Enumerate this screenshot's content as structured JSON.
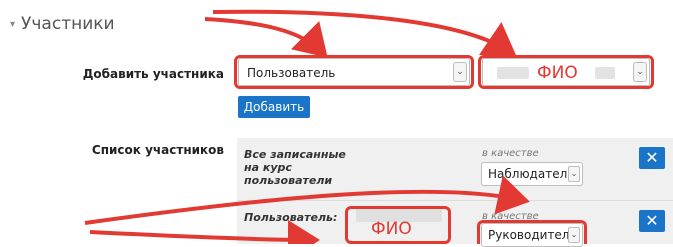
{
  "section": {
    "title": "Участники",
    "caret": "▾"
  },
  "add_participant": {
    "label": "Добавить участника",
    "select_value": "Пользователь",
    "fio_select_value": "ФИО",
    "add_button": "Добавить"
  },
  "participants_list": {
    "label": "Список участников",
    "rows": [
      {
        "who": "Все записанные на курс пользователи",
        "as_label": "в качестве",
        "role": "Наблюдатель",
        "remove": "✕"
      },
      {
        "who": "Пользователь:",
        "fio": "ФИО",
        "as_label": "в качестве",
        "role": "Руководитель",
        "remove": "✕"
      }
    ]
  },
  "annotations": {
    "color": "#e23a33"
  },
  "colors": {
    "accent_blue": "#1a74c8"
  },
  "icons": {
    "dropdown": "chevron-down-icon",
    "remove": "close-icon"
  }
}
